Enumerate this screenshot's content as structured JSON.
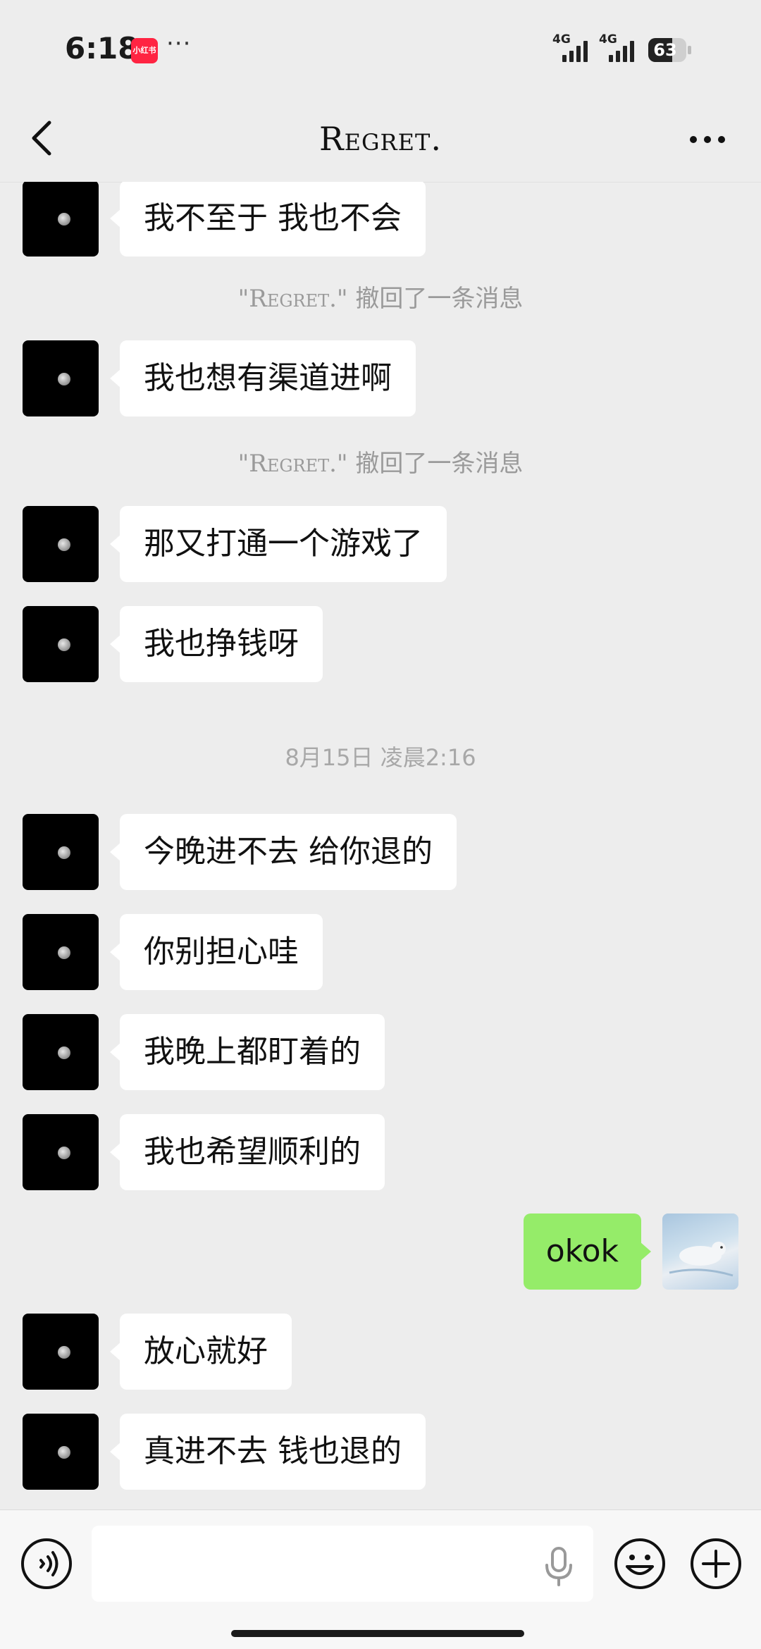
{
  "status_bar": {
    "time": "6:18",
    "app_badge": "小红书",
    "dots": "···",
    "signal_1": "4G",
    "signal_2": "4G",
    "battery": "63"
  },
  "header": {
    "title": "Regret.",
    "back_icon": "chevron-left-icon",
    "more_icon": "more-dots-icon"
  },
  "messages": [
    {
      "side": "left",
      "text": "我不至于 我也不会"
    },
    {
      "system": "\"Regret.\" 撤回了一条消息"
    },
    {
      "side": "left",
      "text": "我也想有渠道进啊"
    },
    {
      "system": "\"Regret.\" 撤回了一条消息"
    },
    {
      "side": "left",
      "text": "那又打通一个游戏了"
    },
    {
      "side": "left",
      "text": "我也挣钱呀"
    },
    {
      "timestamp": "8月15日 凌晨2:16"
    },
    {
      "side": "left",
      "text": "今晚进不去 给你退的"
    },
    {
      "side": "left",
      "text": "你别担心哇"
    },
    {
      "side": "left",
      "text": "我晚上都盯着的"
    },
    {
      "side": "left",
      "text": "我也希望顺利的"
    },
    {
      "side": "right",
      "text": "okok"
    },
    {
      "side": "left",
      "text": "放心就好"
    },
    {
      "side": "left",
      "text": "真进不去 钱也退的"
    }
  ],
  "system_sender": "\"Regret.\"",
  "system_action": "撤回了一条消息",
  "input_bar": {
    "voice_icon": "voice-icon",
    "mic_icon": "microphone-icon",
    "emoji_icon": "emoji-icon",
    "plus_icon": "plus-icon",
    "value": ""
  },
  "colors": {
    "background": "#ededed",
    "bubble_incoming": "#ffffff",
    "bubble_outgoing": "#95ec69",
    "system_text": "#9a9a9a"
  }
}
